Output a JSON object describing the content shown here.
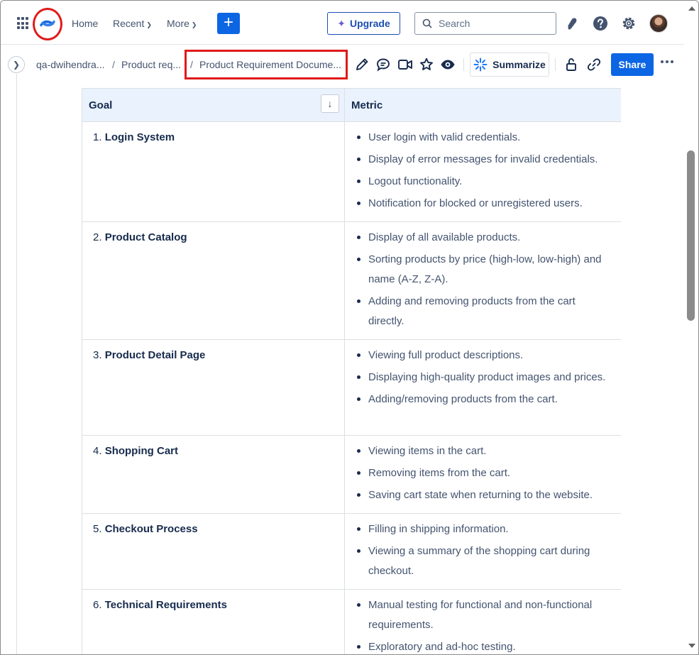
{
  "topnav": {
    "home_label": "Home",
    "recent_label": "Recent",
    "more_label": "More",
    "upgrade_label": "Upgrade",
    "search_placeholder": "Search"
  },
  "breadcrumb": {
    "items": [
      "qa-dwihendra...",
      "Product req...",
      "Product Requirement Docume..."
    ]
  },
  "actions": {
    "summarize_label": "Summarize",
    "share_label": "Share"
  },
  "table": {
    "headers": [
      "Goal",
      "Metric"
    ],
    "rows": [
      {
        "num": "1.",
        "goal": "Login System",
        "metrics": [
          "User login with valid credentials.",
          "Display of error messages for invalid credentials.",
          "Logout functionality.",
          "Notification for blocked or unregistered users."
        ]
      },
      {
        "num": "2.",
        "goal": "Product Catalog",
        "metrics": [
          "Display of all available products.",
          "Sorting products by price (high-low, low-high) and name (A-Z, Z-A).",
          "Adding and removing products from the cart directly."
        ]
      },
      {
        "num": "3.",
        "goal": "Product Detail Page",
        "metrics": [
          "Viewing full product descriptions.",
          "Displaying high-quality product images and prices.",
          "Adding/removing products from the cart."
        ]
      },
      {
        "num": "4.",
        "goal": "Shopping Cart",
        "metrics": [
          "Viewing items in the cart.",
          "Removing items from the cart.",
          "Saving cart state when returning to the website."
        ]
      },
      {
        "num": "5.",
        "goal": "Checkout Process",
        "metrics": [
          "Filling in shipping information.",
          "Viewing a summary of the shopping cart during checkout."
        ]
      },
      {
        "num": "6.",
        "goal": "Technical Requirements",
        "metrics": [
          "Manual testing for functional and non-functional requirements.",
          "Exploratory and ad-hoc testing."
        ]
      }
    ]
  },
  "colors": {
    "brand_blue": "#0c66e4",
    "highlight_red": "#e01a1a",
    "header_bg": "#e9f2fd"
  }
}
